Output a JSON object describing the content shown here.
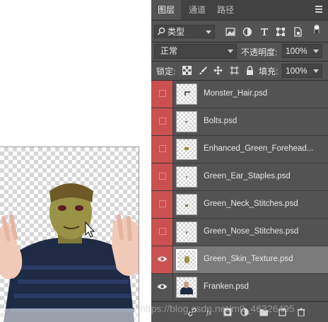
{
  "tabs": [
    {
      "label": "图层",
      "active": true
    },
    {
      "label": "通道",
      "active": false
    },
    {
      "label": "路径",
      "active": false
    }
  ],
  "filter": {
    "kind": "类型"
  },
  "blend_mode": "正常",
  "opacity": {
    "label": "不透明度:",
    "value": "100%"
  },
  "lock": {
    "label": "锁定:"
  },
  "fill": {
    "label": "填充:",
    "value": "100%"
  },
  "layers": [
    {
      "name": "Monster_Hair.psd",
      "visible": false,
      "color": "red",
      "selected": false
    },
    {
      "name": "Bolts.psd",
      "visible": false,
      "color": "red",
      "selected": false
    },
    {
      "name": "Enhanced_Green_Forehead...",
      "visible": false,
      "color": "red",
      "selected": false
    },
    {
      "name": "Green_Ear_Staples.psd",
      "visible": false,
      "color": "red",
      "selected": false
    },
    {
      "name": "Green_Neck_Stitches.psd",
      "visible": false,
      "color": "red",
      "selected": false
    },
    {
      "name": "Green_Nose_Stitches.psd",
      "visible": false,
      "color": "red",
      "selected": false
    },
    {
      "name": "Green_Skin_Texture.psd",
      "visible": true,
      "color": "red",
      "selected": true
    },
    {
      "name": "Franken.psd",
      "visible": true,
      "color": "none",
      "selected": false
    }
  ],
  "watermark": "https://blog.csdn.net/m0_46326495",
  "colors": {
    "panel": "#535353",
    "tabbar": "#424242",
    "red_tag": "#c9514f",
    "selected_row": "#7a7a7a"
  }
}
